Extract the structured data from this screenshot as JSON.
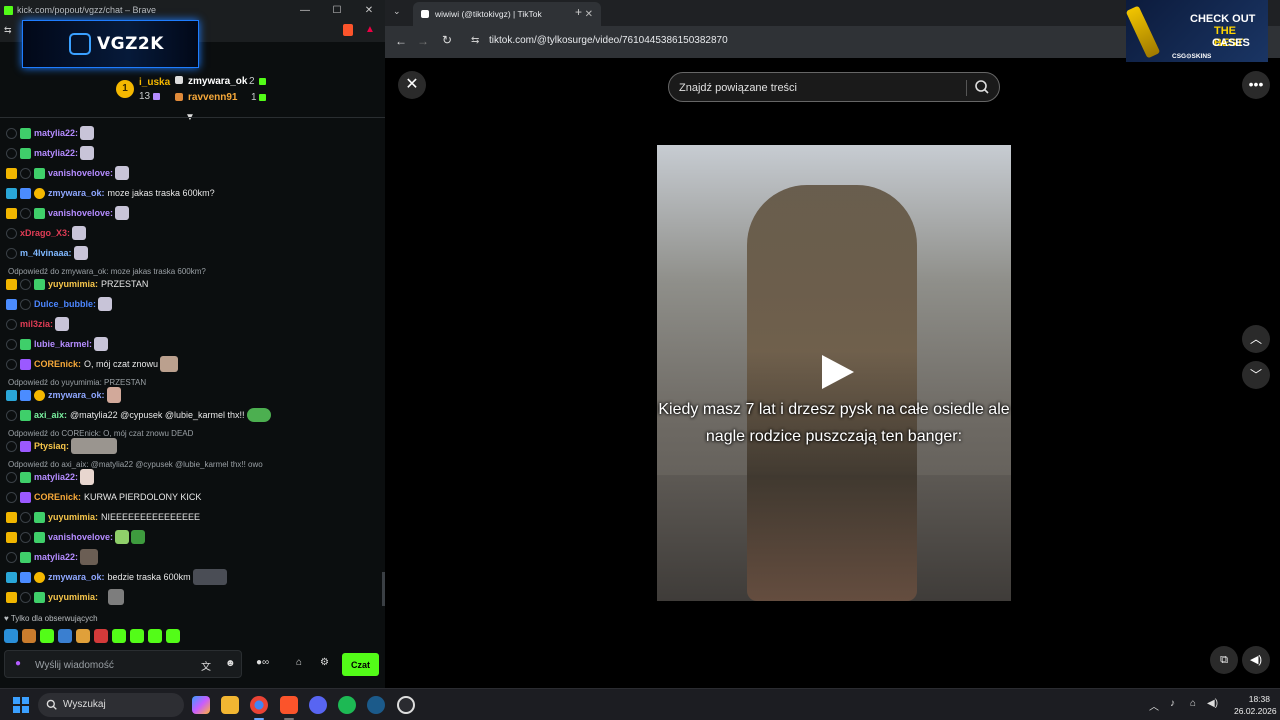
{
  "chat_window": {
    "title": "kick.com/popout/vgzz/chat – Brave",
    "banner_text": "VGZ2K",
    "leaderboard": {
      "first": {
        "rank": "1",
        "name": "i_uska",
        "count": "13"
      },
      "second": {
        "name": "zmywara_ok",
        "count": "2"
      },
      "third": {
        "name": "ravvenn91",
        "count": "1"
      }
    },
    "messages": [
      {
        "user": "matylia22:",
        "text": "",
        "color": "#b58cff"
      },
      {
        "user": "matylia22:",
        "text": "",
        "color": "#b58cff"
      },
      {
        "user": "vanishovelove:",
        "text": "",
        "color": "#b58cff"
      },
      {
        "user": "zmywara_ok:",
        "text": "moze jakas traska 600km?",
        "color": "#8fa7ff"
      },
      {
        "user": "vanishovelove:",
        "text": "",
        "color": "#b58cff"
      },
      {
        "user": "xDrago_X3:",
        "text": "",
        "color": "#e03c55"
      },
      {
        "user": "m_4lvinaaa:",
        "text": "",
        "color": "#7fb8ff"
      },
      {
        "reply": "Odpowiedź do zmywara_ok: moze jakas traska 600km?"
      },
      {
        "user": "yuyumimia:",
        "text": "PRZESTAN",
        "color": "#f7c64b"
      },
      {
        "user": "Dulce_bubble:",
        "text": "",
        "color": "#4c86ff"
      },
      {
        "user": "mil3zia:",
        "text": "",
        "color": "#e03c55"
      },
      {
        "user": "lubie_karmel:",
        "text": "",
        "color": "#b58cff"
      },
      {
        "user": "COREnick:",
        "text": "O, mój czat znowu",
        "color": "#f7a93a"
      },
      {
        "reply": "Odpowiedź do yuyumimia: PRZESTAN"
      },
      {
        "user": "zmywara_ok:",
        "text": "",
        "color": "#8fa7ff"
      },
      {
        "user": "axi_aix:",
        "text": "@matylia22 @cypusek @lubie_karmel thx!!",
        "color": "#7bf2a0"
      },
      {
        "reply": "Odpowiedź do COREnick: O, mój czat znowu DEAD"
      },
      {
        "user": "Ptysiaq:",
        "text": "",
        "color": "#f7c64b"
      },
      {
        "reply": "Odpowiedź do axi_aix: @matylia22 @cypusek @lubie_karmel thx!! owo"
      },
      {
        "user": "matylia22:",
        "text": "",
        "color": "#b58cff"
      },
      {
        "user": "COREnick:",
        "text": "KURWA PIERDOLONY KICK",
        "color": "#f7a93a"
      },
      {
        "user": "yuyumimia:",
        "text": "NIEEEEEEEEEEEEEEE",
        "color": "#f7c64b"
      },
      {
        "user": "vanishovelove:",
        "text": "",
        "color": "#b58cff"
      },
      {
        "user": "matylia22:",
        "text": "",
        "color": "#b58cff"
      },
      {
        "user": "zmywara_ok:",
        "text": "bedzie traska 600km",
        "color": "#8fa7ff"
      },
      {
        "user": "yuyumimia:",
        "text": "",
        "color": "#f7c64b"
      }
    ],
    "followers_only": "Tylko dla obserwujących",
    "input_placeholder": "Wyślij wiadomość",
    "send_label": "Czat"
  },
  "browser": {
    "tab_title": "wiwiwi (@tiktokivgz) | TikTok",
    "url": "tiktok.com/@tylkosurge/video/7610445386150382870",
    "ad": {
      "line1": "CHECK OUT",
      "line2": "THE BEST",
      "line3": "CASES",
      "brand": "CSG⊙SKINS"
    },
    "search_placeholder": "Znajdź powiązane treści",
    "caption": "Kiedy masz 7 lat i drzesz pysk na całe osiedle ale nagle rodzice puszczają ten banger:"
  },
  "taskbar": {
    "search_label": "Wyszukaj",
    "time": "18:38",
    "date": "26.02.2026"
  },
  "colors": {
    "kick_green": "#53fc18",
    "chat_bg": "#0b0e0f"
  }
}
